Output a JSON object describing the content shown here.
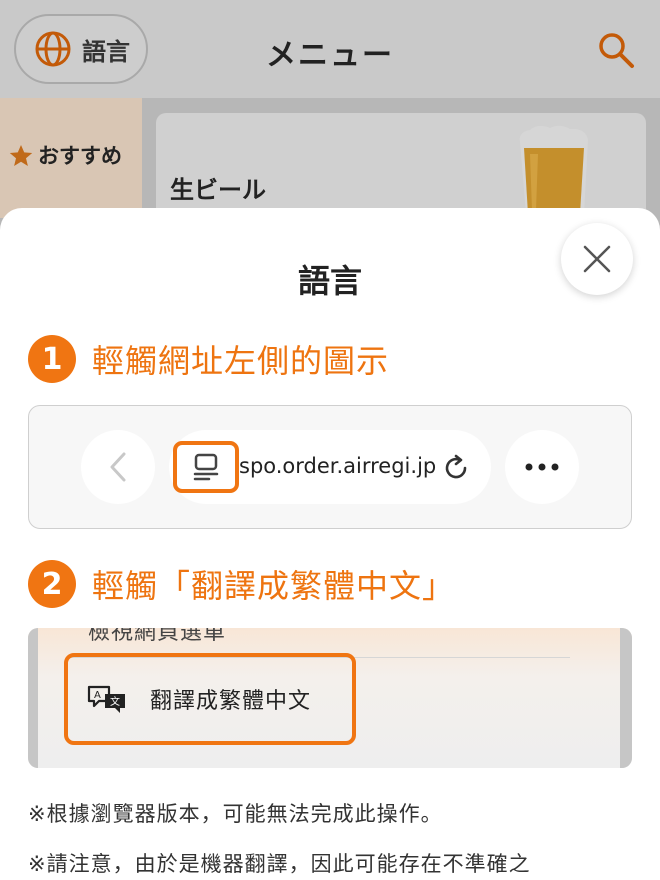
{
  "header": {
    "language_button": "語言",
    "title": "メニュー",
    "search_icon": "search-icon"
  },
  "sidebar": {
    "recommended_label": "おすすめ"
  },
  "menu_card": {
    "title": "生ビール"
  },
  "sheet": {
    "title": "語言",
    "step1": {
      "number": "1",
      "text": "輕觸網址左側的圖示"
    },
    "browser": {
      "url": "spo.order.airregi.jp"
    },
    "step2": {
      "number": "2",
      "text": "輕觸「翻譯成繁體中文」"
    },
    "translate_menu": {
      "cut_item": "檢視網頁選單",
      "item_label": "翻譯成繁體中文"
    },
    "note1": "※根據瀏覽器版本，可能無法完成此操作。",
    "note2": "※請注意，由於是機器翻譯，因此可能存在不準確之"
  },
  "colors": {
    "accent": "#f07512",
    "accent_text": "#ee7410",
    "overlay": "#b7b7b7"
  }
}
